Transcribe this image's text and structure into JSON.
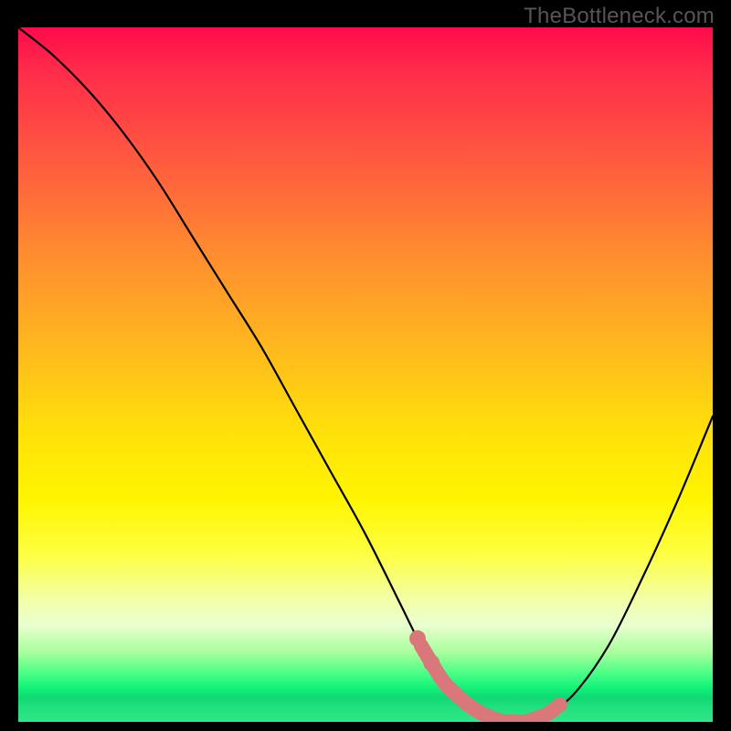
{
  "watermark": "TheBottleneck.com",
  "chart_data": {
    "type": "line",
    "title": "",
    "xlabel": "",
    "ylabel": "",
    "xlim": [
      0,
      100
    ],
    "ylim": [
      0,
      100
    ],
    "legend": false,
    "grid": false,
    "background": "red-yellow-green vertical gradient",
    "series": [
      {
        "name": "bottleneck-curve",
        "x": [
          0,
          5,
          10,
          15,
          20,
          25,
          30,
          35,
          40,
          45,
          50,
          55,
          58,
          61,
          64,
          67,
          70,
          73,
          76,
          80,
          85,
          90,
          95,
          100
        ],
        "y": [
          100,
          96,
          91,
          85,
          78,
          70,
          62,
          54,
          45,
          36,
          27,
          17,
          11,
          6,
          3,
          1,
          0,
          0,
          1,
          4,
          11,
          21,
          32,
          44
        ]
      }
    ],
    "highlight_region": {
      "description": "salmon thick stroke marking the low-bottleneck zone",
      "x_start": 58,
      "x_end": 78,
      "dots_x": [
        57.5,
        59.5
      ]
    },
    "colors": {
      "curve": "#000000",
      "highlight": "#d9777a",
      "gradient_top": "#ff0a4a",
      "gradient_mid": "#fff500",
      "gradient_bottom": "#14f37a"
    }
  }
}
